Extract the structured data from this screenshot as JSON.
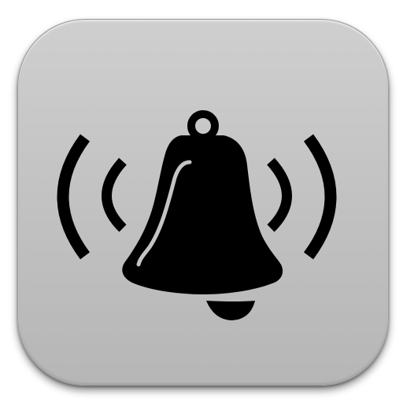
{
  "icon": {
    "name": "ringing-bell-icon",
    "background_color": "#c4c4c4",
    "glyph_color": "#000000",
    "highlight_color": "#c4c4c4"
  }
}
